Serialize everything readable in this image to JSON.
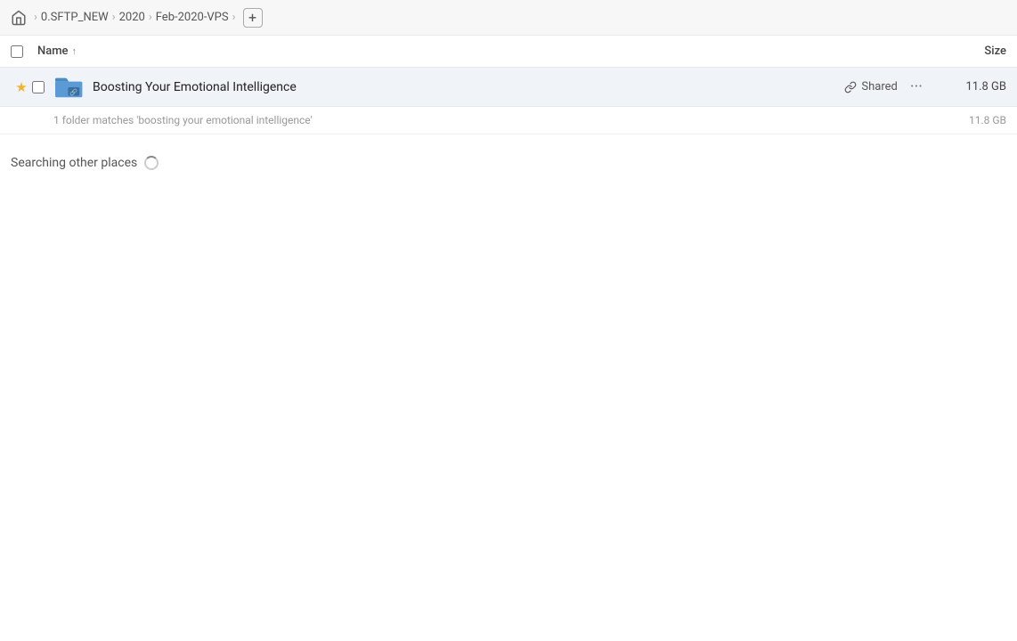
{
  "header": {
    "home_icon": "🏠",
    "breadcrumb": [
      {
        "label": "0.SFTP_NEW"
      },
      {
        "label": "2020"
      },
      {
        "label": "Feb-2020-VPS"
      }
    ],
    "add_button_label": "+"
  },
  "columns": {
    "name_label": "Name",
    "sort_indicator": "↑",
    "size_label": "Size"
  },
  "file_row": {
    "star": "★",
    "name": "Boosting Your Emotional Intelligence",
    "shared_label": "Shared",
    "size": "11.8 GB"
  },
  "match_info": {
    "text": "1 folder matches 'boosting your emotional intelligence'",
    "size": "11.8 GB"
  },
  "searching_section": {
    "label": "Searching other places"
  }
}
